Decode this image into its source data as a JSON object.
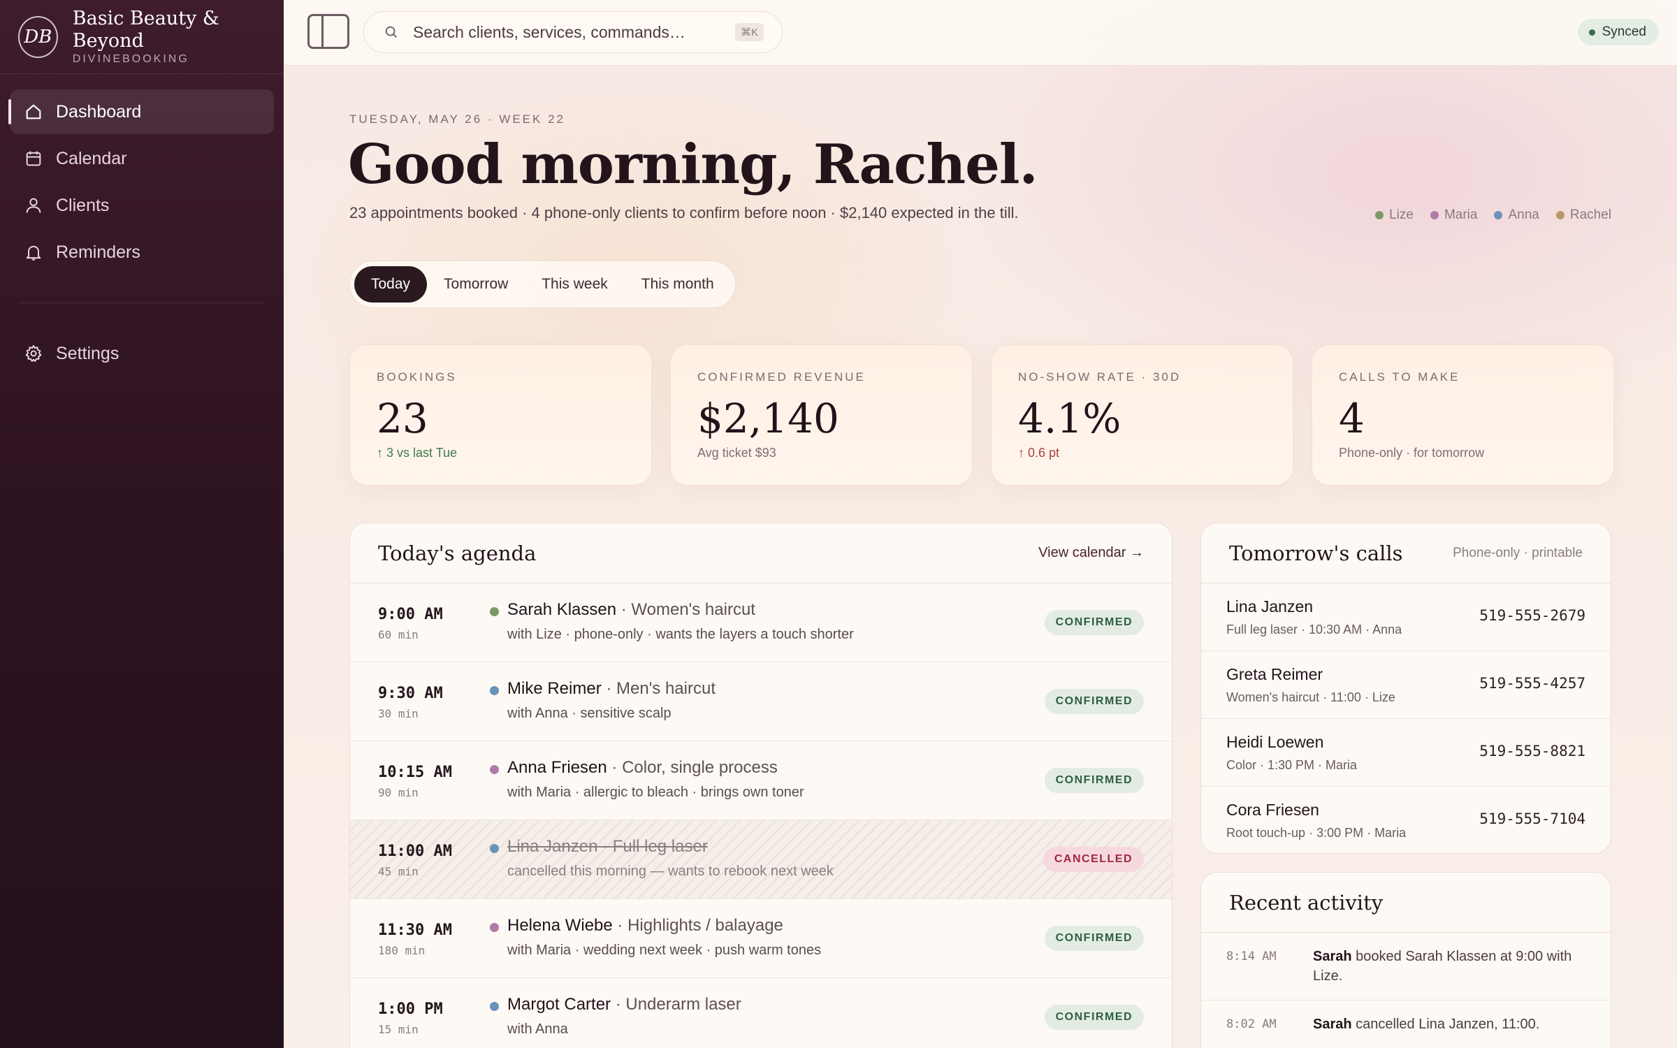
{
  "brand": {
    "mark": "DB",
    "name": "Basic Beauty & Beyond",
    "sub": "DIVINEBOOKING"
  },
  "nav": {
    "dashboard": "Dashboard",
    "calendar": "Calendar",
    "clients": "Clients",
    "reminders": "Reminders",
    "settings": "Settings"
  },
  "search": {
    "placeholder": "Search clients, services, commands…",
    "shortcut": "⌘K"
  },
  "sync_status": "Synced",
  "header": {
    "date_line": "TUESDAY, MAY 26 · WEEK 22",
    "greeting": "Good morning, Rachel.",
    "summary": "23 appointments booked · 4 phone-only clients to confirm before noon · $2,140 expected in the till."
  },
  "staff": [
    {
      "name": "Lize",
      "color": "#7a9a62"
    },
    {
      "name": "Maria",
      "color": "#b07aa8"
    },
    {
      "name": "Anna",
      "color": "#6a93b8"
    },
    {
      "name": "Rachel",
      "color": "#b89a6a"
    }
  ],
  "range_tabs": [
    "Today",
    "Tomorrow",
    "This week",
    "This month"
  ],
  "stats": {
    "bookings": {
      "label": "BOOKINGS",
      "value": "23",
      "sub": "↑ 3 vs last Tue"
    },
    "revenue": {
      "label": "CONFIRMED REVENUE",
      "value": "$2,140",
      "sub": "Avg ticket $93"
    },
    "noshow": {
      "label": "NO-SHOW RATE · 30D",
      "value": "4.1%",
      "sub": "↑ 0.6 pt"
    },
    "calls": {
      "label": "CALLS TO MAKE",
      "value": "4",
      "sub": "Phone-only · for tomorrow"
    }
  },
  "agenda": {
    "title": "Today's agenda",
    "link": "View calendar →",
    "rows": [
      {
        "time": "9:00 AM",
        "duration": "60 min",
        "client": "Sarah Klassen",
        "service": "· Women's haircut",
        "detail": "with Lize · phone-only · wants the layers a touch shorter",
        "status": "CONFIRMED",
        "color": "#7a9a62"
      },
      {
        "time": "9:30 AM",
        "duration": "30 min",
        "client": "Mike Reimer",
        "service": "· Men's haircut",
        "detail": "with Anna · sensitive scalp",
        "status": "CONFIRMED",
        "color": "#6a93b8"
      },
      {
        "time": "10:15 AM",
        "duration": "90 min",
        "client": "Anna Friesen",
        "service": "· Color, single process",
        "detail": "with Maria · allergic to bleach · brings own toner",
        "status": "CONFIRMED",
        "color": "#b07aa8"
      },
      {
        "time": "11:00 AM",
        "duration": "45 min",
        "client": "Lina Janzen",
        "service": "· Full leg laser",
        "detail": "cancelled this morning — wants to rebook next week",
        "status": "CANCELLED",
        "color": "#6a93b8"
      },
      {
        "time": "11:30 AM",
        "duration": "180 min",
        "client": "Helena Wiebe",
        "service": "· Highlights / balayage",
        "detail": "with Maria · wedding next week · push warm tones",
        "status": "CONFIRMED",
        "color": "#b07aa8"
      },
      {
        "time": "1:00 PM",
        "duration": "15 min",
        "client": "Margot Carter",
        "service": "· Underarm laser",
        "detail": "with Anna",
        "status": "CONFIRMED",
        "color": "#6a93b8"
      }
    ]
  },
  "calls": {
    "title": "Tomorrow's calls",
    "note": "Phone-only · printable",
    "rows": [
      {
        "name": "Lina Janzen",
        "detail": "Full leg laser · 10:30 AM · Anna",
        "phone": "519-555-2679"
      },
      {
        "name": "Greta Reimer",
        "detail": "Women's haircut · 11:00 · Lize",
        "phone": "519-555-4257"
      },
      {
        "name": "Heidi Loewen",
        "detail": "Color · 1:30 PM · Maria",
        "phone": "519-555-8821"
      },
      {
        "name": "Cora Friesen",
        "detail": "Root touch-up · 3:00 PM · Maria",
        "phone": "519-555-7104"
      }
    ]
  },
  "activity": {
    "title": "Recent activity",
    "rows": [
      {
        "time": "8:14 AM",
        "actor": "Sarah",
        "text": " booked Sarah Klassen at 9:00 with Lize."
      },
      {
        "time": "8:02 AM",
        "actor": "Sarah",
        "text": " cancelled Lina Janzen, 11:00."
      }
    ]
  }
}
